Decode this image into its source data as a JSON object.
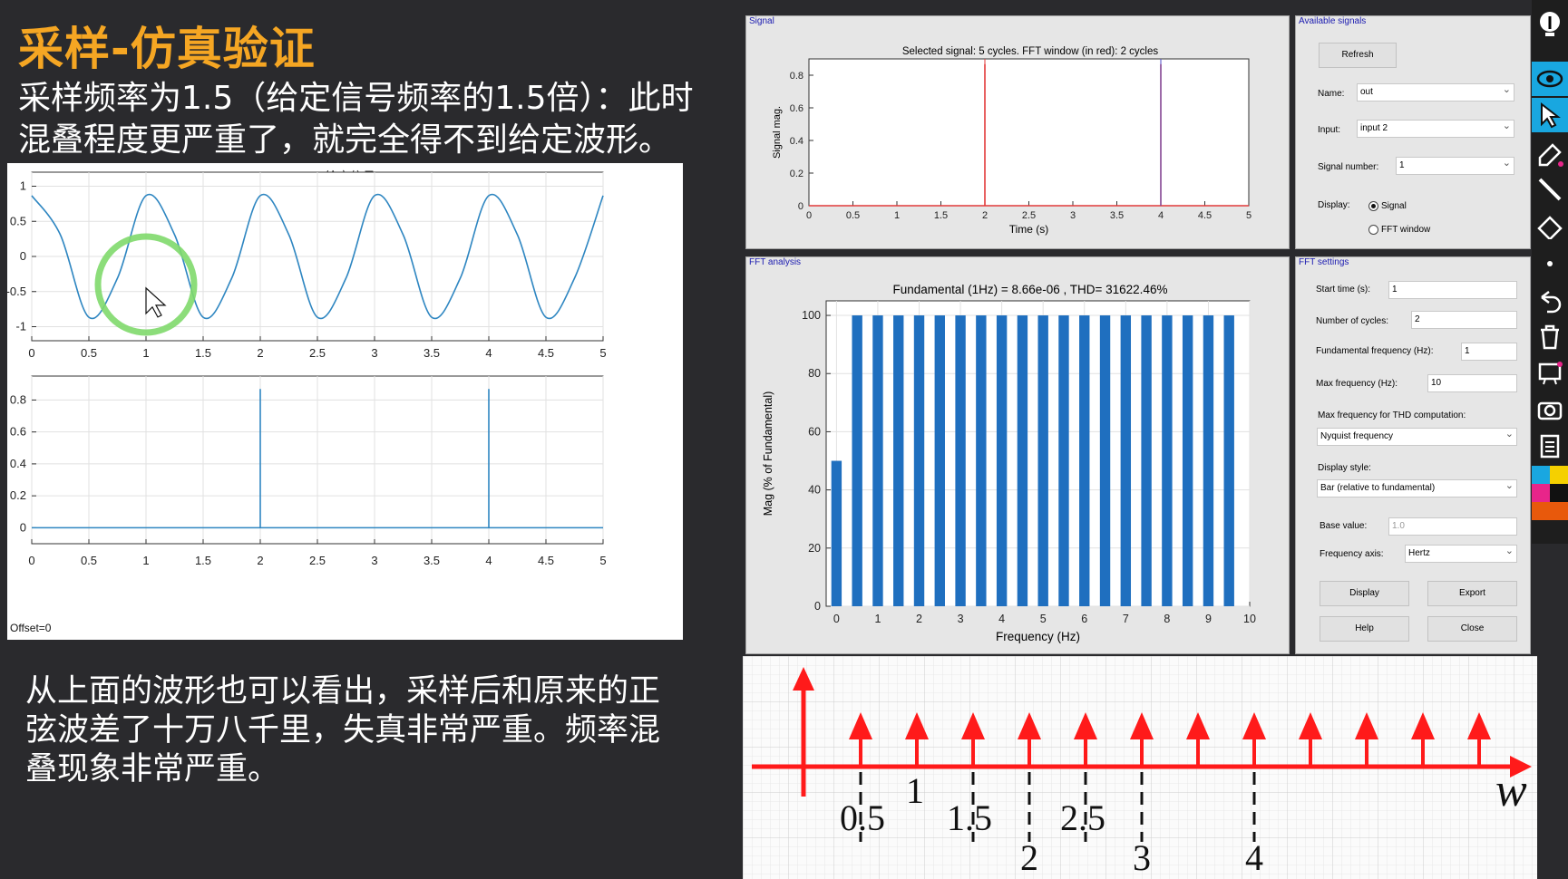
{
  "slide": {
    "title": "采样-仿真验证",
    "description": "采样频率为1.5（给定信号频率的1.5倍）：此时混叠程度更严重了，就完全得不到给定波形。",
    "conclusion": "从上面的波形也可以看出，采样后和原来的正弦波差了十万八千里，失真非常严重。频率混叠现象非常严重。"
  },
  "matlab_figure": {
    "title": "给定信号",
    "offset_label": "Offset=0",
    "colors": {
      "line": "#2e86c1",
      "highlight": "#7fd96b"
    }
  },
  "signal_panel": {
    "label": "Signal",
    "title": "Selected signal: 5 cycles. FFT window (in red): 2 cycles",
    "colors": {
      "window": "#e23a3a",
      "marker": "#4c4cc8"
    }
  },
  "available_signals": {
    "label": "Available signals",
    "refresh_label": "Refresh",
    "name_label": "Name:",
    "name_value": "out",
    "input_label": "Input:",
    "input_value": "input 2",
    "signal_number_label": "Signal number:",
    "signal_number_value": "1",
    "display_label": "Display:",
    "display_options": [
      "Signal",
      "FFT window"
    ],
    "display_selected": "Signal"
  },
  "fft_analysis": {
    "label": "FFT analysis",
    "title": "Fundamental (1Hz) = 8.66e-06 , THD= 31622.46%",
    "bar_color": "#1f6fbf"
  },
  "fft_settings": {
    "label": "FFT settings",
    "start_time_label": "Start time (s):",
    "start_time_value": "1",
    "num_cycles_label": "Number of cycles:",
    "num_cycles_value": "2",
    "fund_freq_label": "Fundamental frequency (Hz):",
    "fund_freq_value": "1",
    "max_freq_label": "Max frequency (Hz):",
    "max_freq_value": "10",
    "thd_label": "Max frequency for THD computation:",
    "thd_value": "Nyquist frequency",
    "display_style_label": "Display style:",
    "display_style_value": "Bar (relative to fundamental)",
    "base_value_label": "Base value:",
    "base_value_value": "1.0",
    "freq_axis_label": "Frequency axis:",
    "freq_axis_value": "Hertz",
    "buttons": {
      "display": "Display",
      "export": "Export",
      "help": "Help",
      "close": "Close"
    }
  },
  "impulse_sketch": {
    "axis_letter": "w",
    "labels_above": [
      "0.5",
      "1",
      "1.5",
      "2.5"
    ],
    "labels_below": [
      "2",
      "3",
      "4"
    ],
    "arrow_color": "#ff1a1a"
  },
  "toolbar": {
    "icons": [
      "bulb-icon",
      "eye-icon",
      "pointer-icon",
      "pen-icon",
      "line-icon",
      "eraser-icon",
      "dot-icon",
      "undo-icon",
      "trash-icon",
      "whiteboard-icon",
      "camera-icon",
      "clipboard-icon"
    ],
    "colors": [
      "#19a7e0",
      "#f5d000",
      "#e8258a",
      "#111111",
      "#e8590c"
    ]
  },
  "chart_data": [
    {
      "type": "line",
      "title": "给定信号",
      "x": [
        0,
        0.25,
        0.5,
        0.75,
        1.0,
        1.25,
        1.5,
        1.75,
        2.0,
        2.25,
        2.5,
        2.75,
        3.0,
        3.25,
        3.5,
        3.75,
        4.0,
        4.25,
        4.5,
        4.75,
        5.0
      ],
      "series": [
        {
          "values": [
            0.866,
            0.31,
            -0.866,
            -0.31,
            0.866,
            0.31,
            -0.866,
            -0.31,
            0.866,
            0.31,
            -0.866,
            -0.31,
            0.866,
            0.31,
            -0.866,
            -0.31,
            0.866,
            0.31,
            -0.866,
            -0.31,
            0.866
          ]
        }
      ],
      "xlim": [
        0,
        5
      ],
      "ylim": [
        -1.2,
        1.2
      ],
      "xticks": [
        "0",
        "0.5",
        "1",
        "1.5",
        "2",
        "2.5",
        "3",
        "3.5",
        "4",
        "4.5",
        "5"
      ],
      "yticks": [
        "1",
        "0.5",
        "0",
        "-0.5",
        "-1"
      ],
      "grid": true
    },
    {
      "type": "line",
      "x": [
        0,
        2,
        2,
        2,
        4,
        4,
        4,
        5
      ],
      "series": [
        {
          "values": [
            0,
            0,
            0.866,
            0,
            0,
            0.866,
            0,
            0
          ]
        }
      ],
      "xlim": [
        0,
        5
      ],
      "ylim": [
        -0.1,
        0.95
      ],
      "xticks": [
        "0",
        "0.5",
        "1",
        "1.5",
        "2",
        "2.5",
        "3",
        "3.5",
        "4",
        "4.5",
        "5"
      ],
      "yticks": [
        "0.8",
        "0.6",
        "0.4",
        "0.2",
        "0"
      ],
      "grid": true
    },
    {
      "type": "line",
      "title": "Selected signal: 5 cycles. FFT window (in red): 2 cycles",
      "x": [
        0,
        2,
        2,
        2,
        4,
        4,
        4,
        5
      ],
      "series": [
        {
          "values": [
            0,
            0,
            0.866,
            0,
            0,
            0.866,
            0,
            0
          ]
        }
      ],
      "markers_x": [
        2,
        4
      ],
      "xlabel": "Time (s)",
      "ylabel": "Signal mag.",
      "xlim": [
        0,
        5
      ],
      "ylim": [
        0,
        0.9
      ],
      "xticks": [
        "0",
        "0.5",
        "1",
        "1.5",
        "2",
        "2.5",
        "3",
        "3.5",
        "4",
        "4.5",
        "5"
      ],
      "yticks": [
        "0.8",
        "0.6",
        "0.4",
        "0.2",
        "0"
      ],
      "grid": false
    },
    {
      "type": "bar",
      "title": "Fundamental (1Hz) = 8.66e-06 , THD= 31622.46%",
      "x": [
        0,
        0.5,
        1,
        1.5,
        2,
        2.5,
        3,
        3.5,
        4,
        4.5,
        5,
        5.5,
        6,
        6.5,
        7,
        7.5,
        8,
        8.5,
        9,
        9.5
      ],
      "values": [
        50,
        100,
        100,
        100,
        100,
        100,
        100,
        100,
        100,
        100,
        100,
        100,
        100,
        100,
        100,
        100,
        100,
        100,
        100,
        100
      ],
      "xlabel": "Frequency (Hz)",
      "ylabel": "Mag (% of Fundamental)",
      "xlim": [
        -0.25,
        10
      ],
      "ylim": [
        0,
        105
      ],
      "xticks": [
        "0",
        "1",
        "2",
        "3",
        "4",
        "5",
        "6",
        "7",
        "8",
        "9",
        "10"
      ],
      "yticks": [
        "100",
        "80",
        "60",
        "40",
        "20",
        "0"
      ],
      "grid": true
    }
  ]
}
